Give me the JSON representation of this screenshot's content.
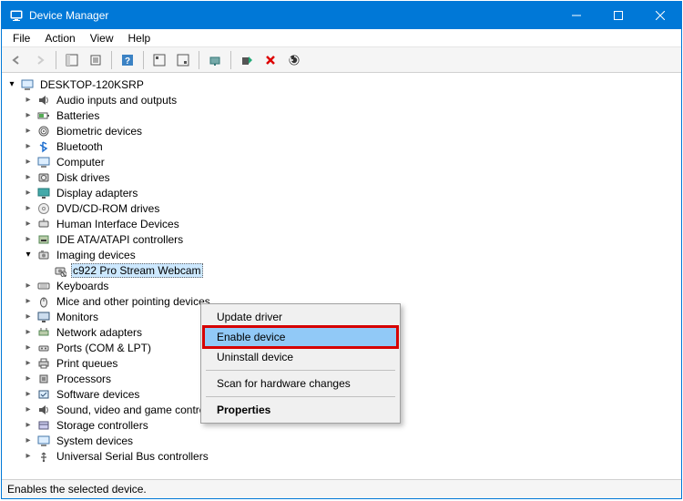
{
  "window": {
    "title": "Device Manager"
  },
  "menu": {
    "file": "File",
    "action": "Action",
    "view": "View",
    "help": "Help"
  },
  "tree": {
    "root": "DESKTOP-120KSRP",
    "categories": [
      {
        "label": "Audio inputs and outputs",
        "icon": "speaker-icon"
      },
      {
        "label": "Batteries",
        "icon": "battery-icon"
      },
      {
        "label": "Biometric devices",
        "icon": "fingerprint-icon"
      },
      {
        "label": "Bluetooth",
        "icon": "bluetooth-icon"
      },
      {
        "label": "Computer",
        "icon": "computer-icon"
      },
      {
        "label": "Disk drives",
        "icon": "disk-icon"
      },
      {
        "label": "Display adapters",
        "icon": "display-icon"
      },
      {
        "label": "DVD/CD-ROM drives",
        "icon": "cd-icon"
      },
      {
        "label": "Human Interface Devices",
        "icon": "hid-icon"
      },
      {
        "label": "IDE ATA/ATAPI controllers",
        "icon": "ide-icon"
      },
      {
        "label": "Imaging devices",
        "icon": "camera-icon"
      },
      {
        "label": "Keyboards",
        "icon": "keyboard-icon"
      },
      {
        "label": "Mice and other pointing devices",
        "icon": "mouse-icon"
      },
      {
        "label": "Monitors",
        "icon": "monitor-icon"
      },
      {
        "label": "Network adapters",
        "icon": "network-icon"
      },
      {
        "label": "Ports (COM & LPT)",
        "icon": "port-icon"
      },
      {
        "label": "Print queues",
        "icon": "printer-icon"
      },
      {
        "label": "Processors",
        "icon": "cpu-icon"
      },
      {
        "label": "Software devices",
        "icon": "software-icon"
      },
      {
        "label": "Sound, video and game controllers",
        "icon": "sound-icon"
      },
      {
        "label": "Storage controllers",
        "icon": "storage-icon"
      },
      {
        "label": "System devices",
        "icon": "system-icon"
      },
      {
        "label": "Universal Serial Bus controllers",
        "icon": "usb-icon"
      }
    ],
    "imaging_child": "c922 Pro Stream Webcam"
  },
  "context_menu": {
    "update_driver": "Update driver",
    "enable_device": "Enable device",
    "uninstall_device": "Uninstall device",
    "scan": "Scan for hardware changes",
    "properties": "Properties"
  },
  "status": {
    "text": "Enables the selected device."
  }
}
